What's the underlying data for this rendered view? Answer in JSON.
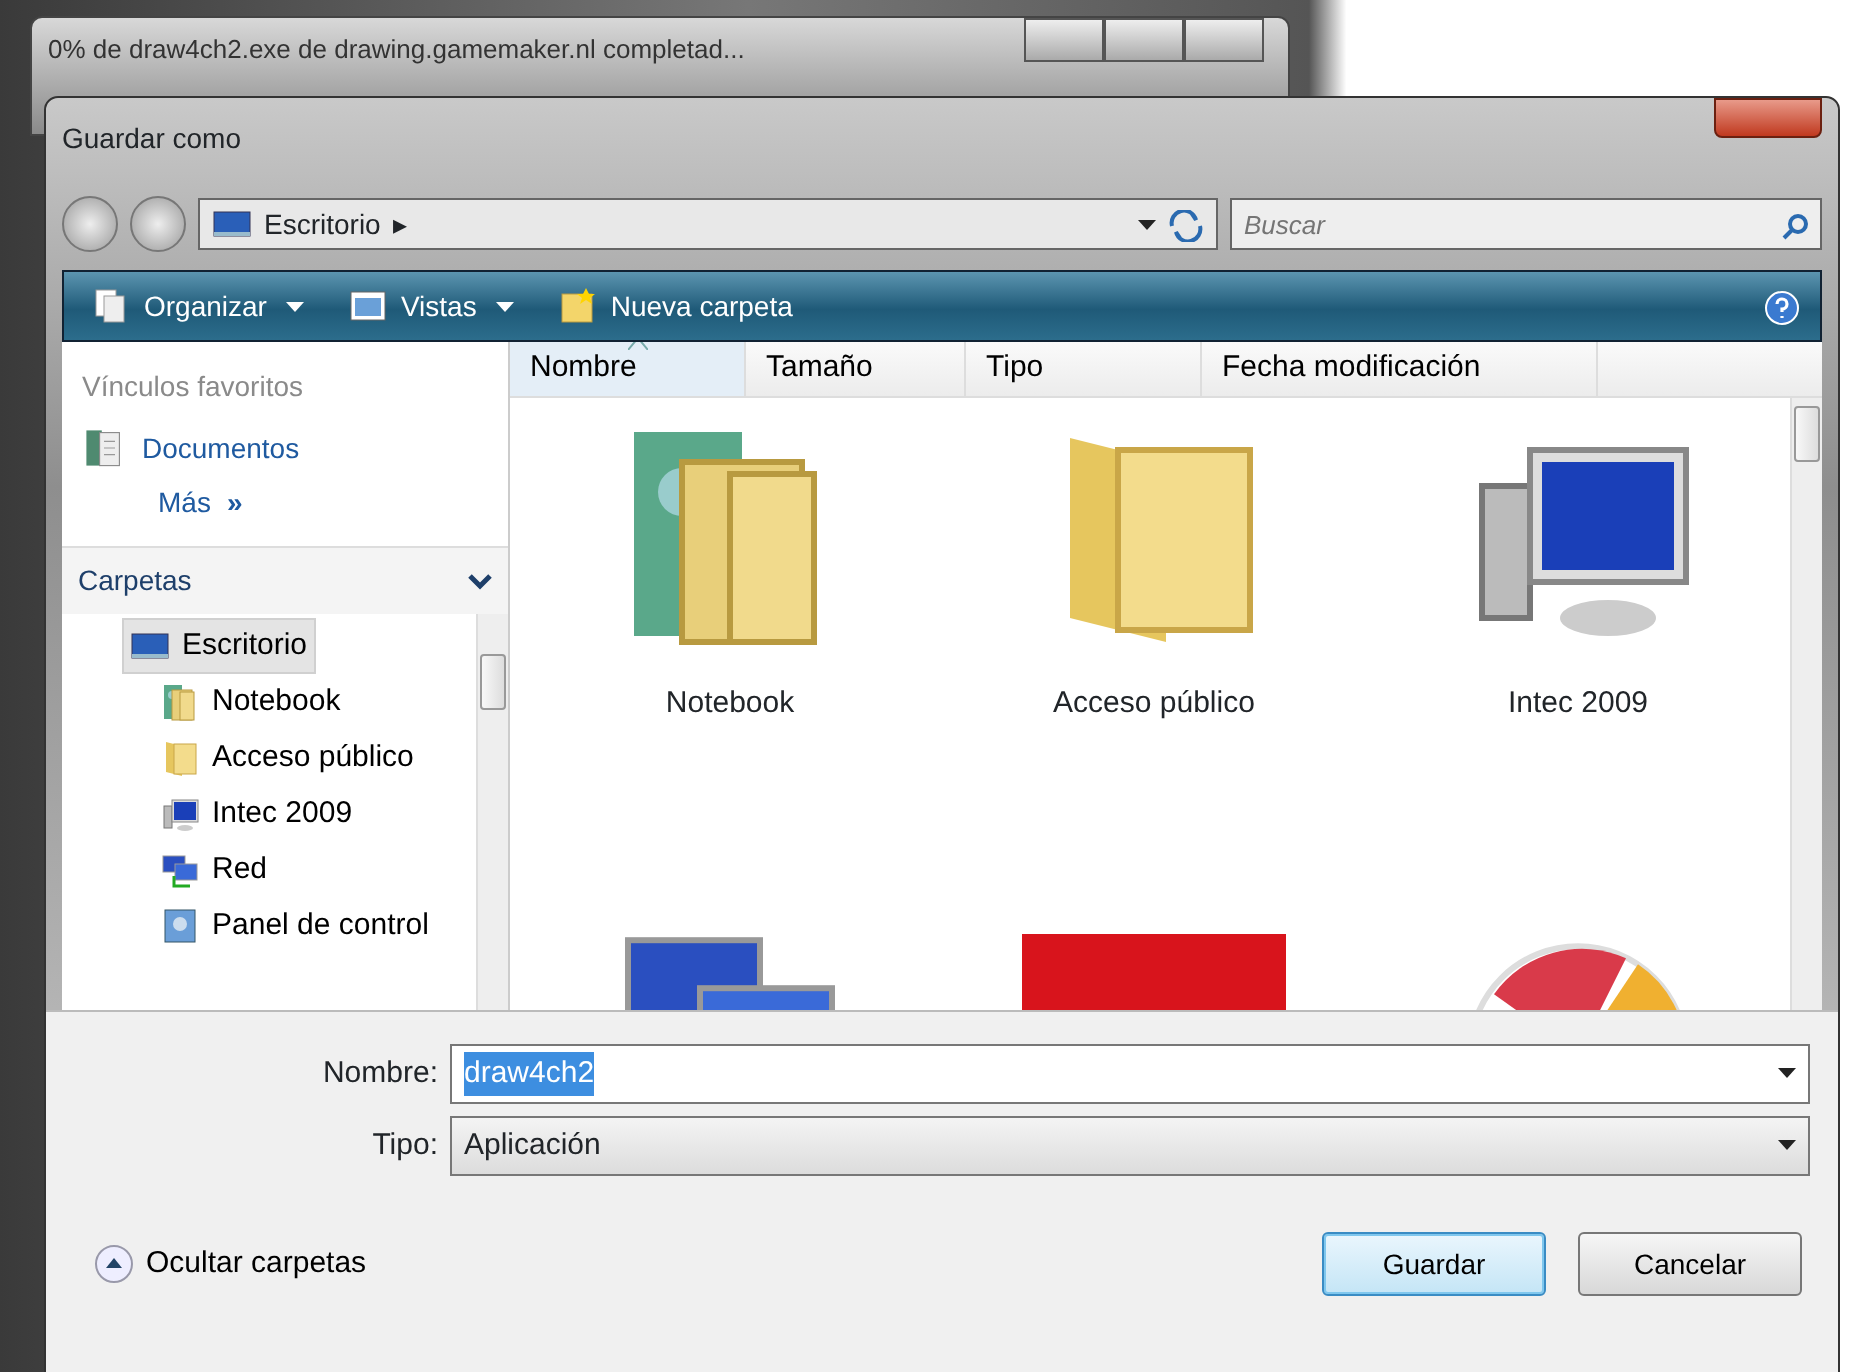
{
  "background_window": {
    "title": "0% de draw4ch2.exe de drawing.gamemaker.nl completad..."
  },
  "dialog": {
    "title": "Guardar como"
  },
  "address_bar": {
    "location": "Escritorio",
    "separator": "▸"
  },
  "search": {
    "placeholder": "Buscar"
  },
  "toolbar": [
    {
      "label": "Organizar",
      "kind": "organize",
      "dropdown": true
    },
    {
      "label": "Vistas",
      "kind": "views",
      "dropdown": true
    },
    {
      "label": "Nueva carpeta",
      "kind": "new-folder",
      "dropdown": false
    }
  ],
  "favorites": {
    "heading": "Vínculos favoritos",
    "items": [
      {
        "label": "Documentos",
        "kind": "documents"
      }
    ],
    "more": "Más",
    "more_icon": "»"
  },
  "folders": {
    "heading": "Carpetas",
    "tree": [
      {
        "label": "Escritorio",
        "kind": "desktop",
        "selected": true,
        "children": [
          {
            "label": "Notebook",
            "kind": "contacts",
            "selected": false
          },
          {
            "label": "Acceso público",
            "kind": "folder",
            "selected": false
          },
          {
            "label": "Intec 2009",
            "kind": "computer",
            "selected": false
          },
          {
            "label": "Red",
            "kind": "network",
            "selected": false
          },
          {
            "label": "Panel de control",
            "kind": "control-panel",
            "selected": false
          }
        ]
      }
    ]
  },
  "columns": [
    {
      "label": "Nombre",
      "sorted": true
    },
    {
      "label": "Tamaño",
      "sorted": false
    },
    {
      "label": "Tipo",
      "sorted": false
    },
    {
      "label": "Fecha modificación",
      "sorted": false
    }
  ],
  "files": [
    {
      "name": "Notebook",
      "kind": "contacts"
    },
    {
      "name": "Acceso público",
      "kind": "folder"
    },
    {
      "name": "Intec 2009",
      "kind": "computer"
    },
    {
      "kind": "network"
    },
    {
      "kind": "red-document"
    },
    {
      "kind": "pie"
    }
  ],
  "form": {
    "filename": {
      "label": "Nombre:",
      "value": "draw4ch2",
      "highlighted": true
    },
    "type": {
      "label": "Tipo:",
      "value": "Aplicación"
    }
  },
  "hide_folders": {
    "label": "Ocultar carpetas"
  },
  "buttons": [
    {
      "label": "Guardar",
      "default": true
    },
    {
      "label": "Cancelar",
      "default": false
    }
  ]
}
